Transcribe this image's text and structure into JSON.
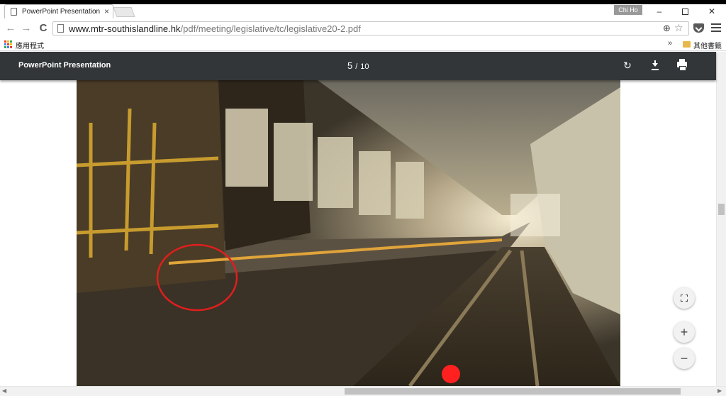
{
  "browser": {
    "tab": {
      "title": "PowerPoint Presentation",
      "close_glyph": "×"
    },
    "profile_name": "Chi Ho",
    "window_controls": {
      "minimize": "–",
      "close": "✕"
    },
    "nav": {
      "back": "←",
      "forward": "→",
      "reload": "C"
    },
    "url": {
      "host": "www.mtr-southislandline.hk",
      "path": "/pdf/meeting/legislative/tc/legislative20-2.pdf"
    },
    "icons": {
      "zoom": "⊕",
      "star": "☆"
    }
  },
  "bookmarks": {
    "apps_label": "應用程式",
    "overflow": "»",
    "other_label": "其他書籤",
    "apps_colors": [
      "#e94235",
      "#fbbc05",
      "#34a853",
      "#4285f4",
      "#e94235",
      "#fbbc05",
      "#34a853",
      "#4285f4",
      "#e94235"
    ]
  },
  "pdf_viewer": {
    "title": "PowerPoint Presentation",
    "current_page": "5",
    "separator": "/",
    "total_pages": "10",
    "icons": {
      "rotate": "↻"
    }
  },
  "zoom_controls": {
    "zoom_in": "+",
    "zoom_out": "−"
  },
  "slide": {
    "colors": {
      "tunnel_light": "#f3ead0",
      "rail": "#8a7a58",
      "highlight_circle": "#e01e1e",
      "signal_light": "#ff2020"
    }
  }
}
